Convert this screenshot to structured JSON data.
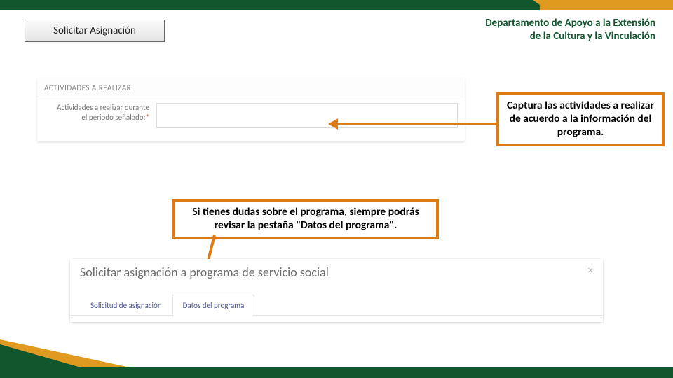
{
  "header": {
    "button_label": "Solicitar Asignación",
    "department_line1": "Departamento de Apoyo a la Extensión",
    "department_line2": "de la Cultura y la Vinculación"
  },
  "activities": {
    "section_title": "ACTIVIDADES A REALIZAR",
    "field_label_l1": "Actividades a realizar durante",
    "field_label_l2": "el periodo señalado:",
    "required_mark": "*"
  },
  "callouts": {
    "right": "Captura las actividades a realizar de acuerdo a la información del programa.",
    "middle": "Si tienes dudas sobre el programa, siempre podrás revisar la pestaña \"Datos del programa\"."
  },
  "modal": {
    "title": "Solicitar asignación a programa de servicio social",
    "close": "×",
    "tabs": [
      {
        "label": "Solicitud de asignación"
      },
      {
        "label": "Datos del programa"
      }
    ]
  }
}
